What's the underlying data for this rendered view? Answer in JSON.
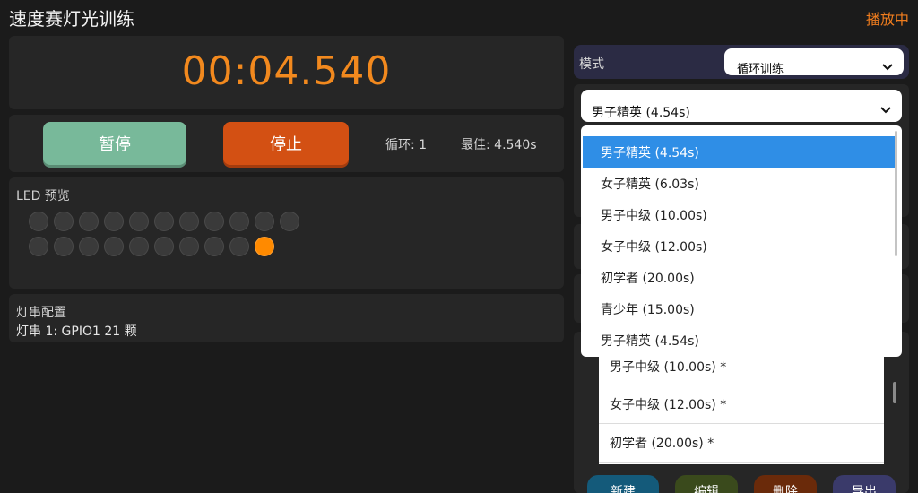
{
  "header": {
    "title": "速度赛灯光训练",
    "status": "播放中"
  },
  "timer": {
    "display": "00:04.540"
  },
  "controls": {
    "pause_label": "暂停",
    "stop_label": "停止",
    "loop_text": "循环: 1",
    "best_text": "最佳: 4.540s"
  },
  "led_preview": {
    "label": "LED 预览",
    "rows": [
      [
        false,
        false,
        false,
        false,
        false,
        false,
        false,
        false,
        false,
        false,
        false
      ],
      [
        false,
        false,
        false,
        false,
        false,
        false,
        false,
        false,
        false,
        true
      ]
    ],
    "on_color": "#ff8a00",
    "off_color": "#3a3a3a"
  },
  "strip_config": {
    "label": "灯串配置",
    "strip_line": "灯串 1: GPIO1  21 颗"
  },
  "mode": {
    "label": "模式",
    "selected": "循环训练"
  },
  "preset": {
    "selected": "男子精英 (4.54s)",
    "options": [
      "男子精英 (4.54s)",
      "女子精英 (6.03s)",
      "男子中级 (10.00s)",
      "女子中级 (12.00s)",
      "初学者 (20.00s)",
      "青少年 (15.00s)",
      "男子精英 (4.54s)"
    ],
    "highlighted_index": 0
  },
  "sequence_list": {
    "items": [
      "男子中级 (10.00s) *",
      "女子中级 (12.00s) *",
      "初学者 (20.00s) *"
    ]
  },
  "actions": {
    "new": "新建",
    "edit": "编辑",
    "delete": "删除",
    "export": "导出"
  },
  "colors": {
    "accent": "#f2891e",
    "pause": "#78b99a",
    "stop": "#d35013",
    "highlight": "#2f8ee6"
  }
}
